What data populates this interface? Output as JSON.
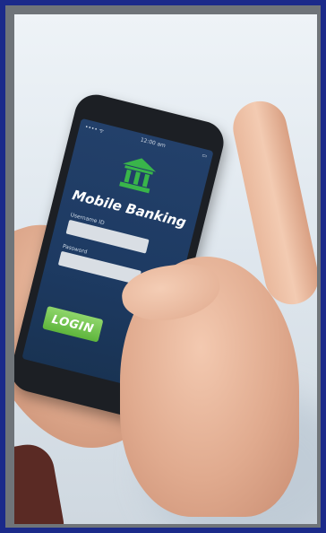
{
  "image": {
    "subject": "phone-in-hands",
    "colors": {
      "outer_border": "#1b2a8a",
      "frame": "#6f7479",
      "screen": "#1d3a62",
      "button": "#6cc04a",
      "icon": "#39b54a"
    }
  },
  "phone_screen": {
    "status_left": "•••• ᯤ",
    "status_center": "12:00 am",
    "status_right": "▭",
    "app_title": "Mobile Banking",
    "field1_label": "Username ID",
    "field2_label": "Password",
    "login_label": "LOGIN",
    "icon": "bank-icon"
  }
}
